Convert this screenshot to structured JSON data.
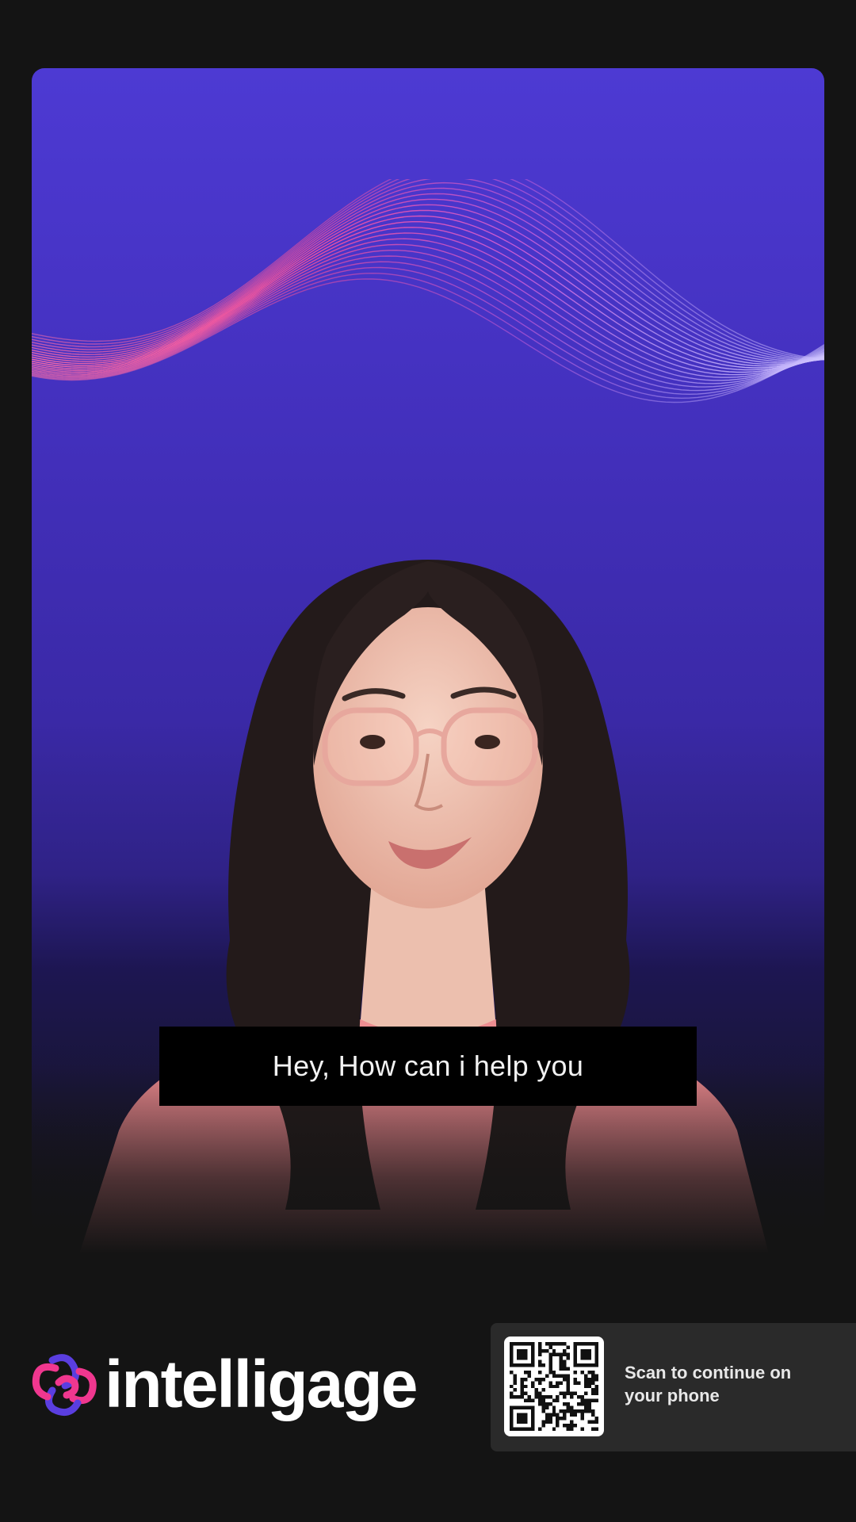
{
  "caption": {
    "text": "Hey, How can i help you"
  },
  "brand": {
    "name": "intelligage",
    "logo_icon": "knot-logo-icon"
  },
  "qr": {
    "label": "Scan to continue on your phone",
    "icon": "qr-code-icon"
  },
  "colors": {
    "page_background": "#141414",
    "stage_top": "#4d3ad3",
    "stage_bottom": "#2f2286",
    "wave_pink": "#f25a9e",
    "wave_light": "#b9a6ff",
    "caption_background": "#000000",
    "qr_card_background": "#2a2a2a",
    "brand_pink": "#f0378f",
    "brand_purple": "#5a3ee0"
  }
}
